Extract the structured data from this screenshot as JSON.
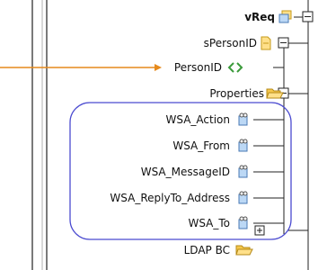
{
  "root": {
    "name": "vReq"
  },
  "nodes": [
    {
      "name": "sPersonID",
      "icon": "document-icon"
    },
    {
      "name": "PersonID",
      "icon": "link-icon"
    },
    {
      "name": "Properties",
      "icon": "folder-open-icon"
    }
  ],
  "properties_children": [
    {
      "name": "WSA_Action",
      "icon": "key-field-icon"
    },
    {
      "name": "WSA_From",
      "icon": "key-field-icon"
    },
    {
      "name": "WSA_MessageID",
      "icon": "key-field-icon"
    },
    {
      "name": "WSA_ReplyTo_Address",
      "icon": "key-field-icon"
    },
    {
      "name": "WSA_To",
      "icon": "key-field-icon"
    }
  ],
  "bottom_node": {
    "name": "LDAP BC",
    "icon": "folder-icon",
    "expander": "+"
  },
  "colors": {
    "mapping_line": "#e68a1c",
    "selection_outline": "#4a4ad0",
    "tree_line": "#222222"
  }
}
